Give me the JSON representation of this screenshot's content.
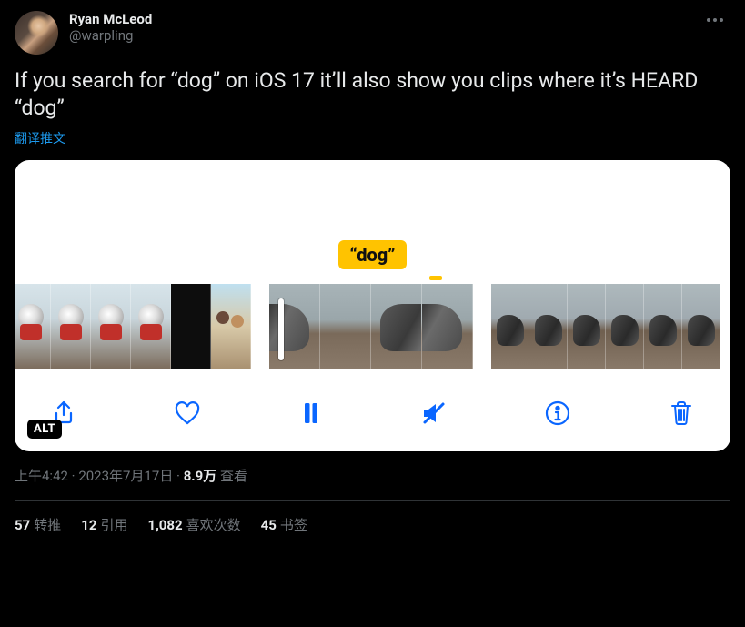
{
  "author": {
    "display_name": "Ryan McLeod",
    "handle": "@warpling"
  },
  "tweet_text": "If you search for “dog” on iOS 17 it’ll also show you clips where it’s HEARD “dog”",
  "translate_label": "翻译推文",
  "media": {
    "callout": "“dog”",
    "alt_badge": "ALT",
    "toolbar": {
      "share": "share-icon",
      "like": "heart-icon",
      "pause": "pause-icon",
      "mute": "mute-icon",
      "info": "info-icon",
      "trash": "trash-icon"
    }
  },
  "meta": {
    "time": "上午4:42",
    "dot1": " · ",
    "date": "2023年7月17日",
    "dot2": " · ",
    "views_number": "8.9万",
    "views_label": " 查看"
  },
  "stats": {
    "retweets_num": "57",
    "retweets_label": "转推",
    "quotes_num": "12",
    "quotes_label": "引用",
    "likes_num": "1,082",
    "likes_label": "喜欢次数",
    "bookmarks_num": "45",
    "bookmarks_label": "书签"
  }
}
